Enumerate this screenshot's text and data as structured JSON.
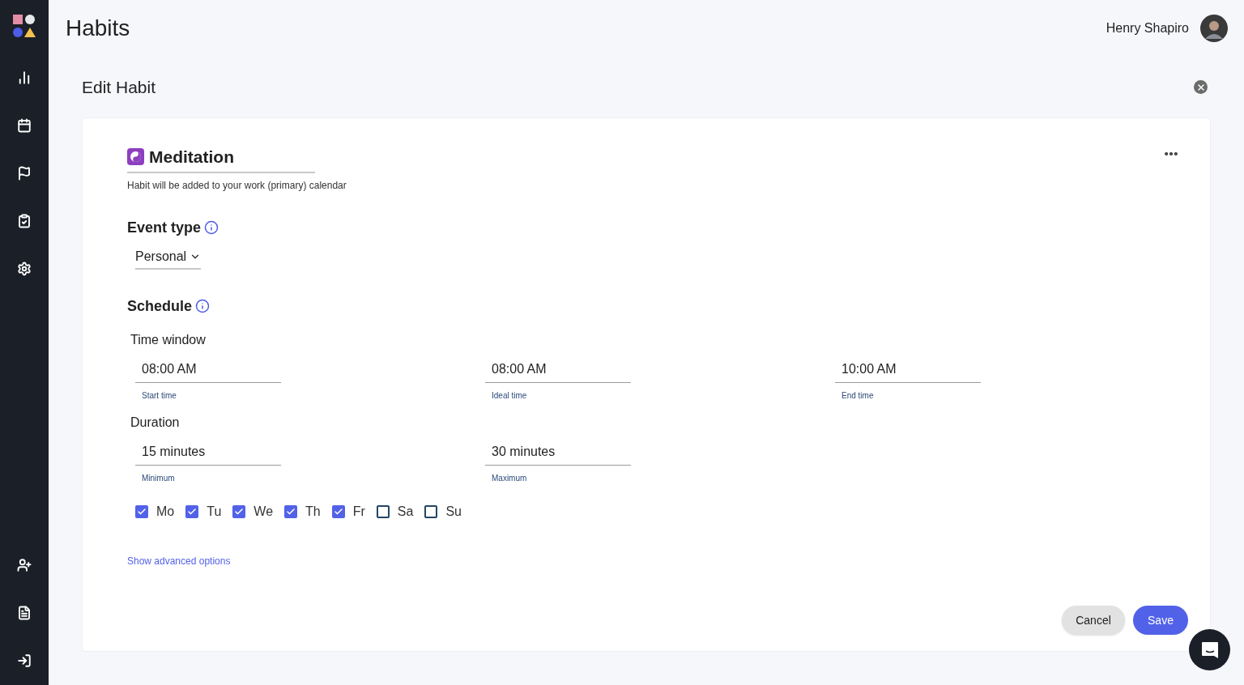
{
  "header": {
    "title": "Habits",
    "user_name": "Henry Shapiro"
  },
  "dialog": {
    "title": "Edit Habit"
  },
  "habit": {
    "name": "Meditation",
    "note": "Habit will be added to your work (primary) calendar"
  },
  "event_type": {
    "label": "Event type",
    "value": "Personal"
  },
  "schedule": {
    "label": "Schedule",
    "time_window": {
      "label": "Time window",
      "fields": [
        {
          "value": "08:00 AM",
          "caption": "Start time"
        },
        {
          "value": "08:00 AM",
          "caption": "Ideal time"
        },
        {
          "value": "10:00 AM",
          "caption": "End time"
        }
      ]
    },
    "duration": {
      "label": "Duration",
      "fields": [
        {
          "value": "15 minutes",
          "caption": "Minimum"
        },
        {
          "value": "30 minutes",
          "caption": "Maximum"
        }
      ]
    },
    "days": [
      {
        "label": "Mo",
        "checked": true
      },
      {
        "label": "Tu",
        "checked": true
      },
      {
        "label": "We",
        "checked": true
      },
      {
        "label": "Th",
        "checked": true
      },
      {
        "label": "Fr",
        "checked": true
      },
      {
        "label": "Sa",
        "checked": false
      },
      {
        "label": "Su",
        "checked": false
      }
    ]
  },
  "advanced_link": "Show advanced options",
  "buttons": {
    "cancel": "Cancel",
    "save": "Save"
  }
}
